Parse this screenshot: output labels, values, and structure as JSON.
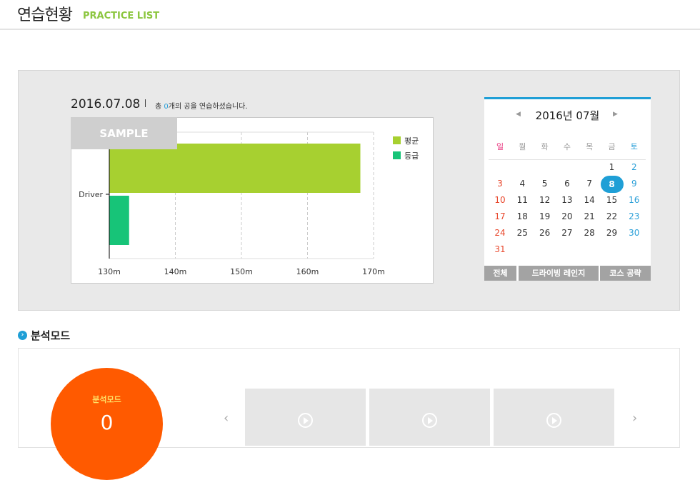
{
  "header": {
    "title": "연습현황",
    "subtitle": "PRACTICE LIST"
  },
  "practice": {
    "date": "2016.07.08",
    "summary_prefix": "총 ",
    "count": "0",
    "summary_suffix": "개의 공을 연습하셨습니다.",
    "sample_label": "SAMPLE"
  },
  "chart_data": {
    "type": "bar",
    "orientation": "horizontal",
    "categories": [
      "Driver"
    ],
    "series": [
      {
        "name": "평균",
        "values": [
          168
        ],
        "color": "#a7d030"
      },
      {
        "name": "등급",
        "values": [
          133
        ],
        "color": "#17c478"
      }
    ],
    "xlim": [
      130,
      170
    ],
    "xticks": [
      "130m",
      "140m",
      "150m",
      "160m",
      "170m"
    ],
    "grid": "vertical-dashed",
    "legend": "top-right"
  },
  "calendar": {
    "prev_icon": "chevron-left-icon",
    "next_icon": "chevron-right-icon",
    "month_label": "2016년 07월",
    "weekdays": [
      "일",
      "월",
      "화",
      "수",
      "목",
      "금",
      "토"
    ],
    "start_weekday": 5,
    "days_in_month": 31,
    "selected_day": 8,
    "buttons": [
      "전체",
      "드라이빙 레인지",
      "코스 공략"
    ]
  },
  "analysis": {
    "title": "분석모드",
    "circle_label": "분석모드",
    "circle_value": "0",
    "circle_color": "#ff5a00",
    "prev_icon": "chevron-left-icon",
    "next_icon": "chevron-right-icon",
    "thumbnails": 3
  }
}
